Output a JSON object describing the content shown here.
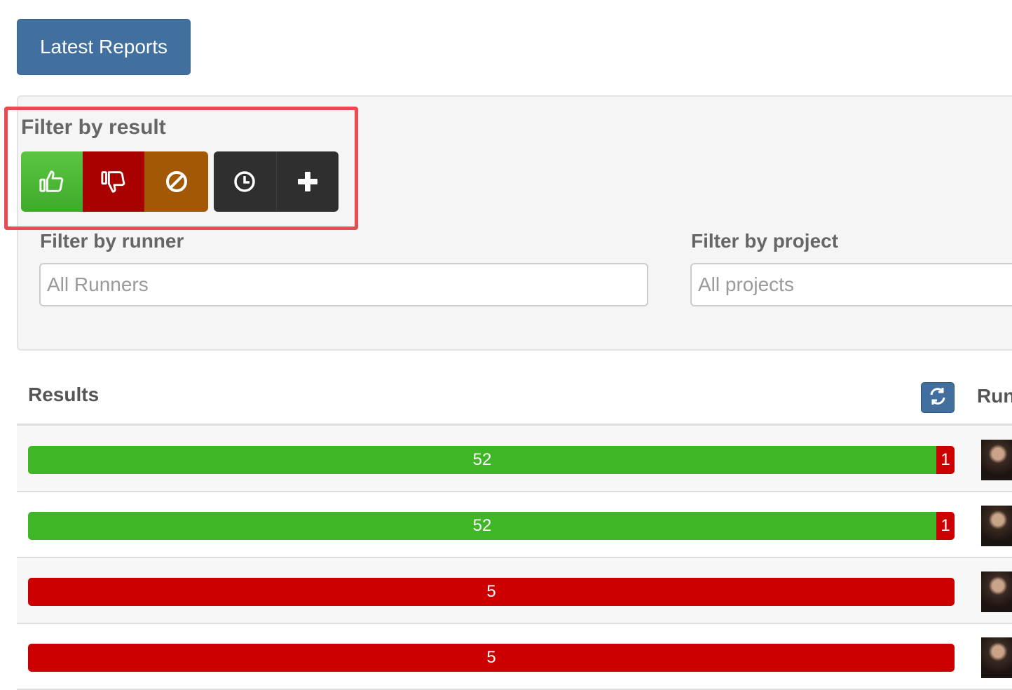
{
  "header": {
    "latest_reports_label": "Latest Reports"
  },
  "filters": {
    "result_label": "Filter by result",
    "result_buttons": [
      {
        "icon": "thumbs-up-icon",
        "color": "#3fab2a"
      },
      {
        "icon": "thumbs-down-icon",
        "color": "#a90000"
      },
      {
        "icon": "ban-icon",
        "color": "#a35806"
      },
      {
        "icon": "clock-icon",
        "color": "#2f2f2f"
      },
      {
        "icon": "plus-icon",
        "color": "#2f2f2f"
      }
    ],
    "runner_label": "Filter by runner",
    "runner_placeholder": "All Runners",
    "project_label": "Filter by project",
    "project_placeholder": "All projects"
  },
  "results": {
    "header_label": "Results",
    "runner_header_label": "Run",
    "refresh_icon": "refresh-icon",
    "rows": [
      {
        "pass": 52,
        "fail": 1,
        "pass_label": "52",
        "fail_label": "1"
      },
      {
        "pass": 52,
        "fail": 1,
        "pass_label": "52",
        "fail_label": "1"
      },
      {
        "pass": 0,
        "fail": 5,
        "pass_label": "",
        "fail_label": "5"
      },
      {
        "pass": 0,
        "fail": 5,
        "pass_label": "",
        "fail_label": "5"
      }
    ]
  },
  "colors": {
    "accent": "#41709f",
    "pass": "#3eb625",
    "fail": "#cc0000",
    "highlight": "#ea4a52"
  }
}
